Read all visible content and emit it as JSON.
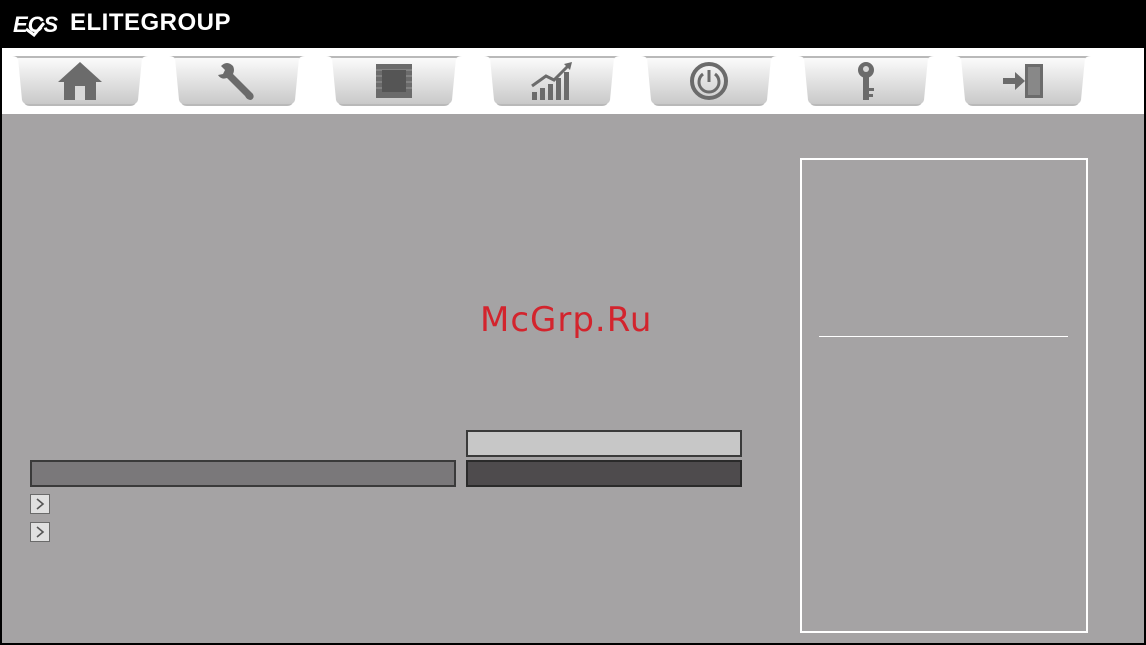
{
  "header": {
    "logo_text": "ECS",
    "brand_name": "ELITEGROUP"
  },
  "tabs": [
    {
      "name": "tab-main",
      "icon": "home-icon"
    },
    {
      "name": "tab-advanced",
      "icon": "wrench-icon"
    },
    {
      "name": "tab-chipset",
      "icon": "chip-icon"
    },
    {
      "name": "tab-mib",
      "icon": "chart-icon"
    },
    {
      "name": "tab-boot",
      "icon": "power-icon"
    },
    {
      "name": "tab-security",
      "icon": "key-icon"
    },
    {
      "name": "tab-exit",
      "icon": "exit-icon"
    }
  ],
  "watermark": "McGrp.Ru",
  "colors": {
    "background": "#a5a3a4",
    "watermark": "#d3242d",
    "highlight_row": "#7a787a",
    "selected_value": "#4e4b4d",
    "light_value": "#c7c7c7"
  }
}
